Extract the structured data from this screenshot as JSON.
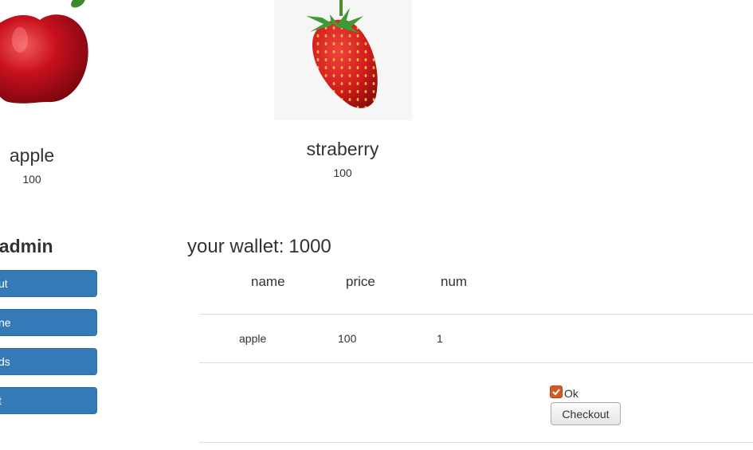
{
  "products": [
    {
      "name": "apple",
      "price": "100",
      "icon": "apple-image"
    },
    {
      "name": "straberry",
      "price": "100",
      "icon": "strawberry-image"
    }
  ],
  "sidebar": {
    "welcome": ", admin",
    "buttons": [
      "ut",
      "ne",
      "ds",
      "t"
    ],
    "button_color": "#337ab7"
  },
  "wallet": {
    "label": "your wallet:",
    "value": "1000"
  },
  "cart": {
    "headers": [
      "name",
      "price",
      "num"
    ],
    "rows": [
      {
        "name": "apple",
        "price": "100",
        "num": "1"
      }
    ],
    "ok_label": "Ok",
    "ok_checked": true,
    "checkout_label": "Checkout",
    "accent": "#d15a28"
  }
}
